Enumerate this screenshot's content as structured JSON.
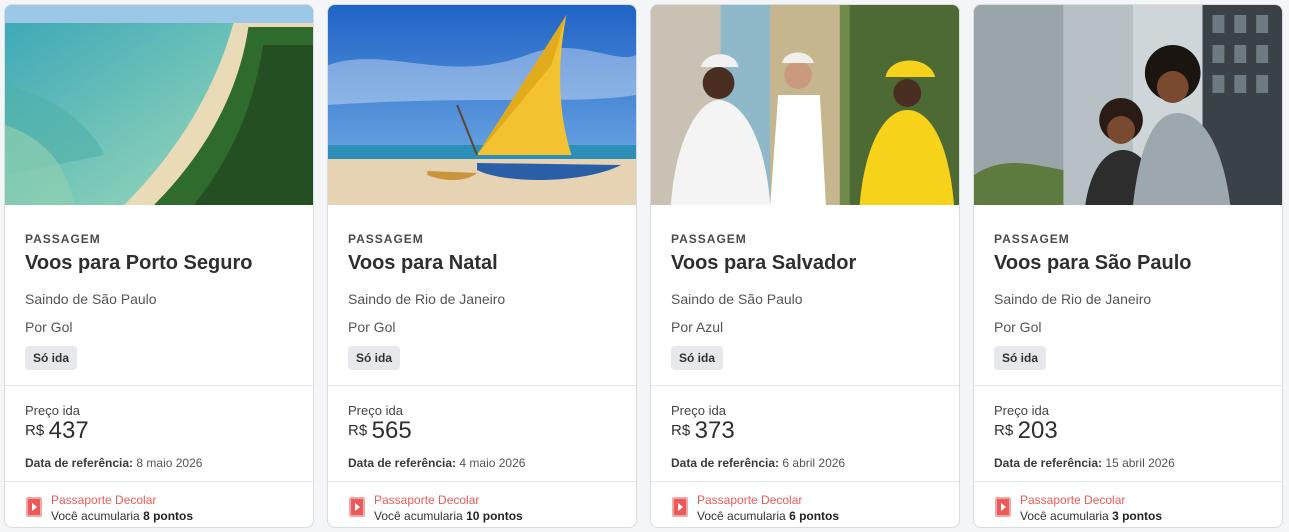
{
  "cards": [
    {
      "kind": "PASSAGEM",
      "title": "Voos para Porto Seguro",
      "origin": "Saindo de São Paulo",
      "airline": "Por Gol",
      "badge": "Só ida",
      "price_label": "Preço ida",
      "currency": "R$",
      "price": "437",
      "ref_label": "Data de referência:",
      "ref_date": "8 maio 2026",
      "program": "Passaporte Decolar",
      "accrue_text": "Você acumularia",
      "points": "8 pontos",
      "image_icon": "beach-coast-photo"
    },
    {
      "kind": "PASSAGEM",
      "title": "Voos para Natal",
      "origin": "Saindo de Rio de Janeiro",
      "airline": "Por Gol",
      "badge": "Só ida",
      "price_label": "Preço ida",
      "currency": "R$",
      "price": "565",
      "ref_label": "Data de referência:",
      "ref_date": "4 maio 2026",
      "program": "Passaporte Decolar",
      "accrue_text": "Você acumularia",
      "points": "10 pontos",
      "image_icon": "sailboat-beach-photo"
    },
    {
      "kind": "PASSAGEM",
      "title": "Voos para Salvador",
      "origin": "Saindo de São Paulo",
      "airline": "Por Azul",
      "badge": "Só ida",
      "price_label": "Preço ida",
      "currency": "R$",
      "price": "373",
      "ref_label": "Data de referência:",
      "ref_date": "6 abril 2026",
      "program": "Passaporte Decolar",
      "accrue_text": "Você acumularia",
      "points": "6 pontos",
      "image_icon": "dancers-street-photo"
    },
    {
      "kind": "PASSAGEM",
      "title": "Voos para São Paulo",
      "origin": "Saindo de Rio de Janeiro",
      "airline": "Por Gol",
      "badge": "Só ida",
      "price_label": "Preço ida",
      "currency": "R$",
      "price": "203",
      "ref_label": "Data de referência:",
      "ref_date": "15 abril 2026",
      "program": "Passaporte Decolar",
      "accrue_text": "Você acumularia",
      "points": "3 pontos",
      "image_icon": "city-couple-photo"
    }
  ],
  "colors": {
    "program": "#ea5a5a",
    "badge_bg": "#e6e8ec",
    "border": "#d9dce1"
  }
}
